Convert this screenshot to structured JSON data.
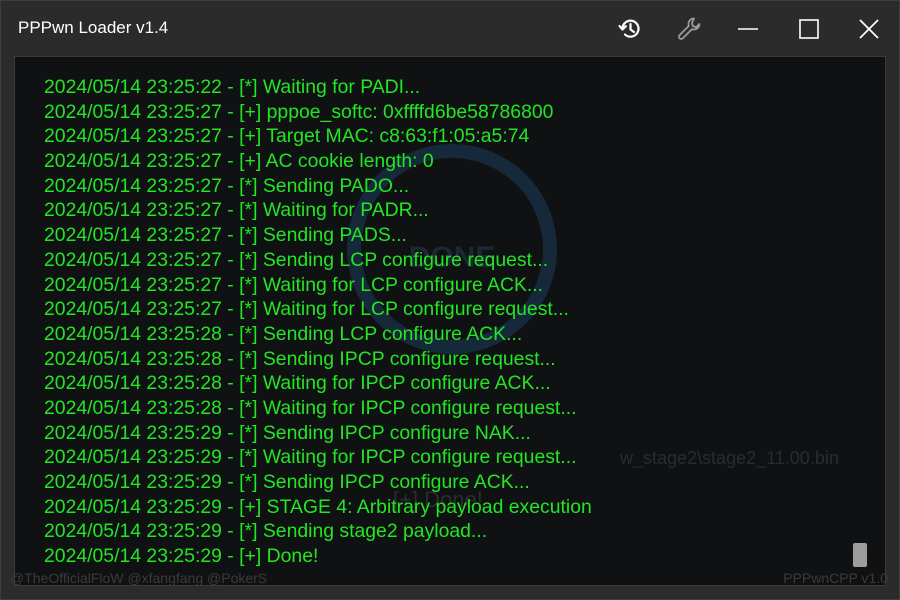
{
  "window": {
    "title": "PPPwn Loader v1.4"
  },
  "titlebar_buttons": [
    {
      "name": "history-icon"
    },
    {
      "name": "wrench-icon"
    },
    {
      "name": "minimize-icon"
    },
    {
      "name": "maximize-icon"
    },
    {
      "name": "close-icon"
    }
  ],
  "watermark": {
    "done_text": "DONE",
    "path_text": "w_stage2\\stage2_11.00.bin",
    "status_text": "[+] Done!"
  },
  "log": [
    "2024/05/14 23:25:22 - [*] Waiting for PADI...",
    "2024/05/14 23:25:27 - [+] pppoe_softc: 0xffffd6be58786800",
    "2024/05/14 23:25:27 - [+] Target MAC: c8:63:f1:05:a5:74",
    "2024/05/14 23:25:27 - [+] AC cookie length: 0",
    "2024/05/14 23:25:27 - [*] Sending PADO...",
    "2024/05/14 23:25:27 - [*] Waiting for PADR...",
    "2024/05/14 23:25:27 - [*] Sending PADS...",
    "2024/05/14 23:25:27 - [*] Sending LCP configure request...",
    "2024/05/14 23:25:27 - [*] Waiting for LCP configure ACK...",
    "2024/05/14 23:25:27 - [*] Waiting for LCP configure request...",
    "2024/05/14 23:25:28 - [*] Sending LCP configure ACK...",
    "2024/05/14 23:25:28 - [*] Sending IPCP configure request...",
    "2024/05/14 23:25:28 - [*] Waiting for IPCP configure ACK...",
    "2024/05/14 23:25:28 - [*] Waiting for IPCP configure request...",
    "2024/05/14 23:25:29 - [*] Sending IPCP configure NAK...",
    "2024/05/14 23:25:29 - [*] Waiting for IPCP configure request...",
    "2024/05/14 23:25:29 - [*] Sending IPCP configure ACK...",
    "2024/05/14 23:25:29 - [+] STAGE 4: Arbitrary payload execution",
    "2024/05/14 23:25:29 - [*] Sending stage2 payload...",
    "2024/05/14 23:25:29 - [+] Done!"
  ],
  "footer": {
    "credits": "@TheOfficialFloW @xfangfang @PokerS",
    "version": "PPPwnCPP v1.0"
  },
  "colors": {
    "log_text": "#22e622",
    "background": "#2b2b2b",
    "console_background": "#0f1113"
  }
}
